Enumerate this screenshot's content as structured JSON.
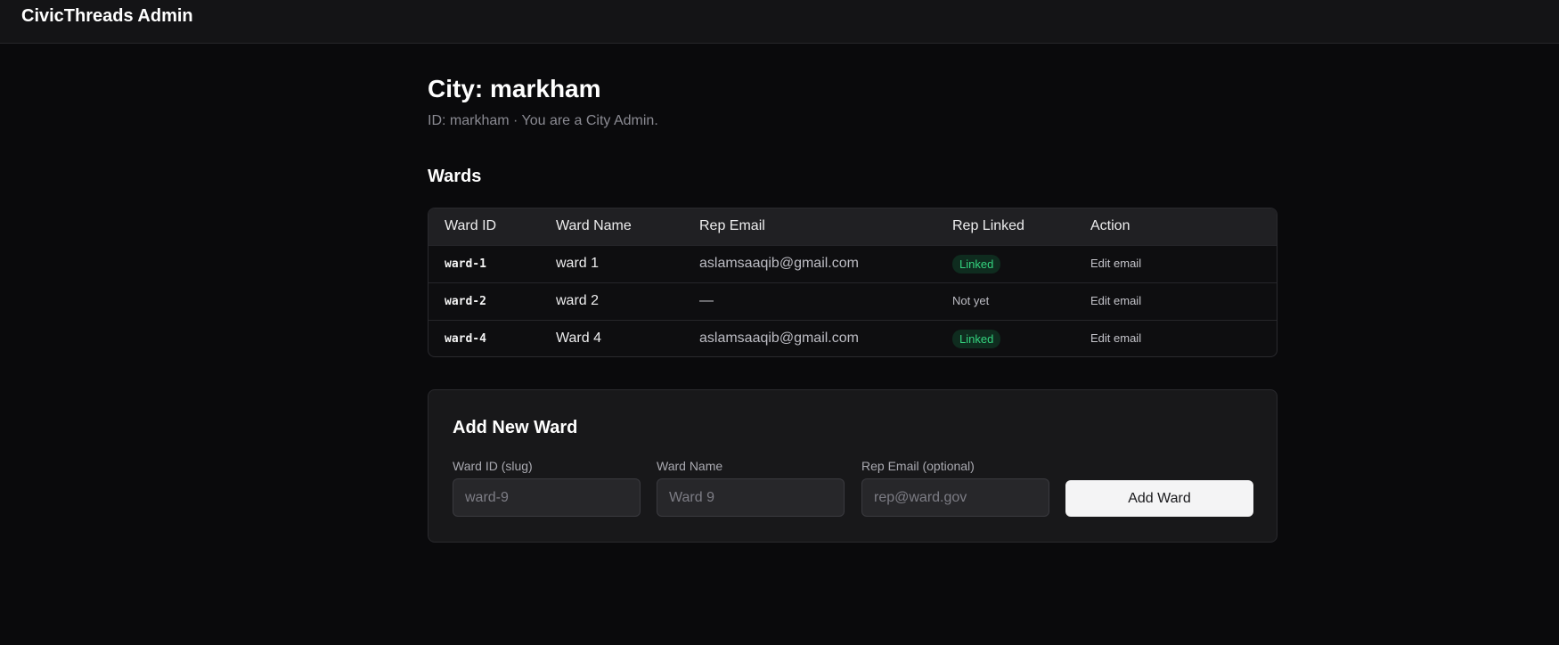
{
  "app": {
    "title": "CivicThreads Admin"
  },
  "page": {
    "title": "City: markham",
    "subtitle": "ID: markham · You are a City Admin."
  },
  "wards_section": {
    "title": "Wards",
    "columns": [
      "Ward ID",
      "Ward Name",
      "Rep Email",
      "Rep Linked",
      "Action"
    ],
    "rows": [
      {
        "ward_id": "ward-1",
        "ward_name": "ward 1",
        "rep_email": "aslamsaaqib@gmail.com",
        "rep_linked": "Linked",
        "linked": true,
        "action": "Edit email"
      },
      {
        "ward_id": "ward-2",
        "ward_name": "ward 2",
        "rep_email": "—",
        "rep_linked": "Not yet",
        "linked": false,
        "action": "Edit email"
      },
      {
        "ward_id": "ward-4",
        "ward_name": "Ward 4",
        "rep_email": "aslamsaaqib@gmail.com",
        "rep_linked": "Linked",
        "linked": true,
        "action": "Edit email"
      }
    ]
  },
  "add_form": {
    "title": "Add New Ward",
    "ward_id": {
      "label": "Ward ID (slug)",
      "placeholder": "ward-9",
      "value": ""
    },
    "ward_name": {
      "label": "Ward Name",
      "placeholder": "Ward 9",
      "value": ""
    },
    "rep_email": {
      "label": "Rep Email (optional)",
      "placeholder": "rep@ward.gov",
      "value": ""
    },
    "submit_label": "Add Ward"
  },
  "colors": {
    "background": "#0a0a0c",
    "topbar": "#141416",
    "linked_badge_bg": "#0f2c1f",
    "linked_badge_text": "#34d27e",
    "button_bg": "#f4f4f5"
  }
}
